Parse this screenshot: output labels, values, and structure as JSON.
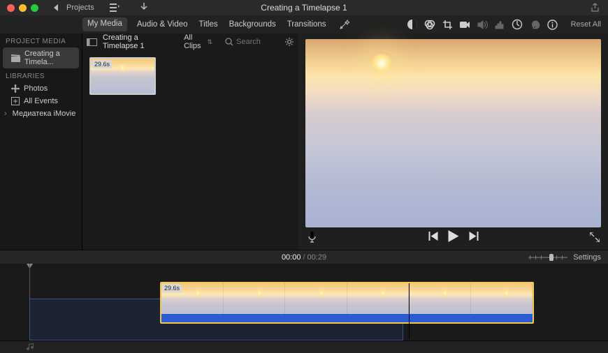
{
  "window": {
    "title": "Creating a Timelapse 1"
  },
  "header": {
    "projects_label": "Projects"
  },
  "tabs": [
    {
      "label": "My Media",
      "active": true
    },
    {
      "label": "Audio & Video",
      "active": false
    },
    {
      "label": "Titles",
      "active": false
    },
    {
      "label": "Backgrounds",
      "active": false
    },
    {
      "label": "Transitions",
      "active": false
    }
  ],
  "viewer_toolbar": {
    "reset_label": "Reset All"
  },
  "sidebar": {
    "sections": [
      {
        "header": "PROJECT MEDIA",
        "items": [
          {
            "label": "Creating a Timela...",
            "icon": "clapper",
            "selected": true
          }
        ]
      },
      {
        "header": "LIBRARIES",
        "items": [
          {
            "label": "Photos",
            "icon": "flower",
            "selected": false
          },
          {
            "label": "All Events",
            "icon": "plus-square",
            "selected": false
          },
          {
            "label": "Медиатека iMovie",
            "icon": "disclosure",
            "selected": false
          }
        ]
      }
    ]
  },
  "browser": {
    "event_name": "Creating a Timelapse 1",
    "filter": "All Clips",
    "search_placeholder": "Search",
    "clips": [
      {
        "duration": "29.6s"
      }
    ]
  },
  "time": {
    "current": "00:00",
    "total": "00:29"
  },
  "timeline": {
    "clip_duration": "29.6s",
    "settings_label": "Settings"
  }
}
